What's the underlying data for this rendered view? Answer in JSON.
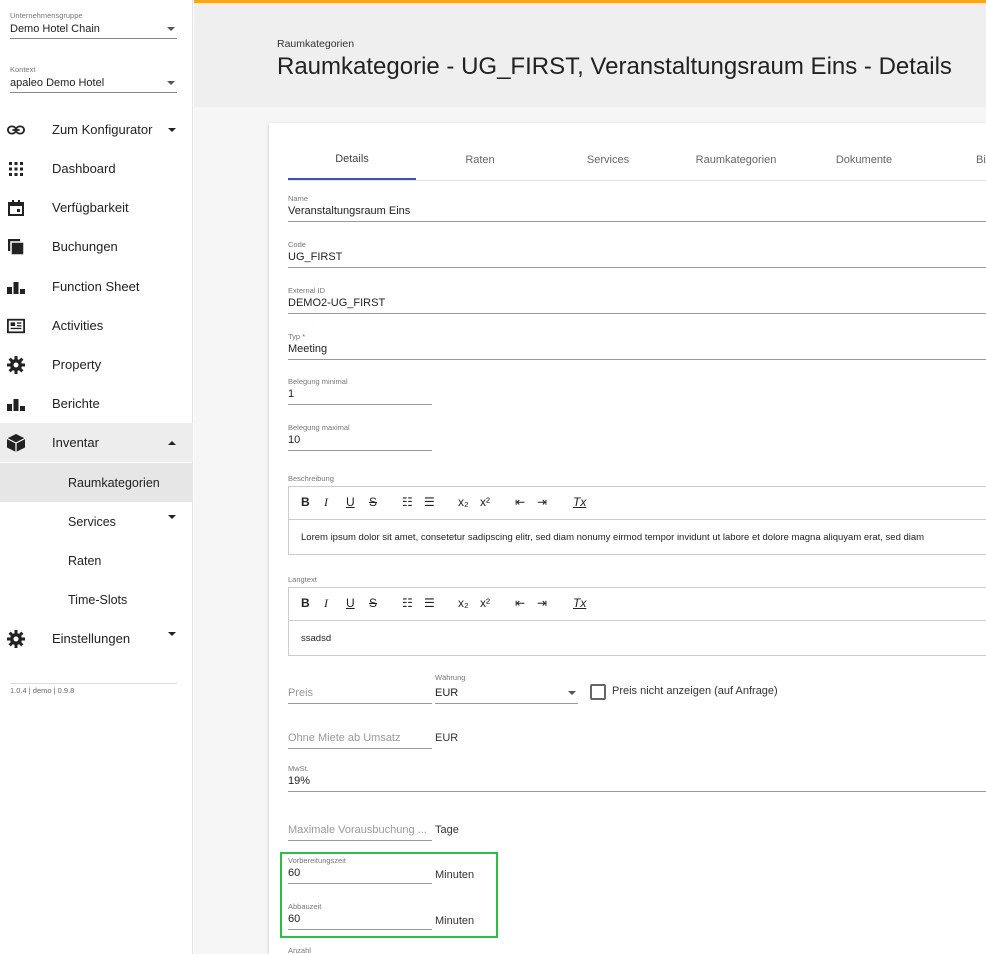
{
  "sidebar": {
    "group_label": "Unternehmensgruppe",
    "group_value": "Demo Hotel Chain",
    "context_label": "Kontext",
    "context_value": "apaleo Demo Hotel",
    "items": [
      {
        "label": "Zum Konfigurator",
        "icon": "link-icon"
      },
      {
        "label": "Dashboard",
        "icon": "grid-icon"
      },
      {
        "label": "Verfügbarkeit",
        "icon": "calendar-icon"
      },
      {
        "label": "Buchungen",
        "icon": "stack-icon"
      },
      {
        "label": "Function Sheet",
        "icon": "bar-chart-icon"
      },
      {
        "label": "Activities",
        "icon": "newspaper-icon"
      },
      {
        "label": "Property",
        "icon": "gear-icon"
      },
      {
        "label": "Berichte",
        "icon": "bar-chart-icon"
      },
      {
        "label": "Inventar",
        "icon": "cube-icon"
      },
      {
        "label": "Einstellungen",
        "icon": "gear-icon"
      }
    ],
    "sub_items": [
      {
        "label": "Raumkategorien"
      },
      {
        "label": "Services"
      },
      {
        "label": "Raten"
      },
      {
        "label": "Time-Slots"
      }
    ],
    "version": "1.0.4 | demo | 0.9.8"
  },
  "header": {
    "breadcrumb": "Raumkategorien",
    "title": "Raumkategorie - UG_FIRST, Veranstaltungsraum Eins - Details"
  },
  "tabs": [
    "Details",
    "Raten",
    "Services",
    "Raumkategorien",
    "Dokumente",
    "Bi"
  ],
  "form": {
    "name_label": "Name",
    "name_value": "Veranstaltungsraum Eins",
    "code_label": "Code",
    "code_value": "UG_FIRST",
    "external_id_label": "External ID",
    "external_id_value": "DEMO2-UG_FIRST",
    "typ_label": "Typ",
    "typ_required": "*",
    "typ_value": "Meeting",
    "min_label": "Belegung minimal",
    "min_value": "1",
    "max_label": "Belegung maximal",
    "max_value": "10",
    "beschreibung_label": "Beschreibung",
    "beschreibung_text": "Lorem ipsum dolor sit amet, consetetur sadipscing elitr, sed diam nonumy eirmod tempor invidunt ut labore et dolore magna aliquyam erat, sed diam",
    "langtext_label": "Langtext",
    "langtext_text": "ssadsd",
    "preis_placeholder": "Preis",
    "waehrung_label": "Währung",
    "waehrung_value": "EUR",
    "checkbox_label": "Preis nicht anzeigen (auf Anfrage)",
    "ohne_miete_placeholder": "Ohne Miete ab Umsatz",
    "ohne_miete_unit": "EUR",
    "mwst_label": "MwSt.",
    "mwst_value": "19%",
    "vorausbuchung_placeholder": "Maximale Vorausbuchung ...",
    "vorausbuchung_unit": "Tage",
    "vorbereitung_label": "Vorbereitungszeit",
    "vorbereitung_value": "60",
    "vorbereitung_unit": "Minuten",
    "abbau_label": "Abbauzeit",
    "abbau_value": "60",
    "abbau_unit": "Minuten",
    "anzahl_label": "Anzahl"
  },
  "toolbar": {
    "bold": "B",
    "italic": "I",
    "underline": "U",
    "strike": "S",
    "ordered": "☷",
    "bullet": "☰",
    "sub": "x₂",
    "sup": "x²",
    "outdent": "⇤",
    "indent": "⇥",
    "clear": "Tx"
  },
  "colors": {
    "accent": "#f5a623",
    "tab_indicator": "#3f51b5",
    "highlight": "#2ebd4a",
    "required": "#e53935"
  }
}
